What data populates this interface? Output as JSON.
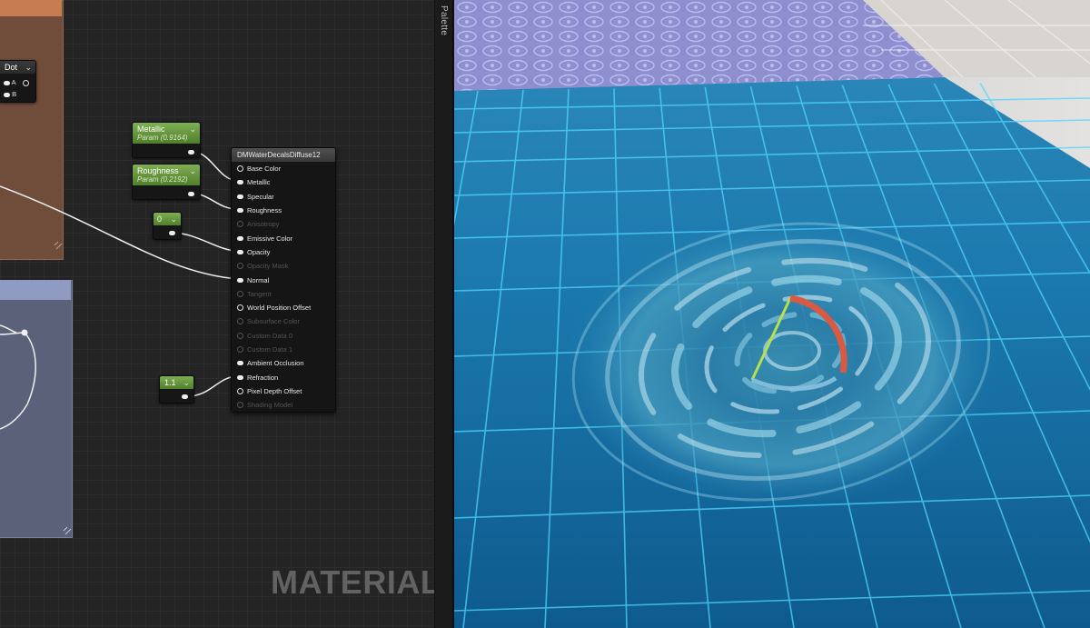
{
  "palette": {
    "label": "Palette"
  },
  "dot_node": {
    "title": "Dot",
    "pin_a": "A",
    "pin_b": "B"
  },
  "metallic_param": {
    "title": "Metallic",
    "subtitle": "Param (0.9164)"
  },
  "roughness_param": {
    "title": "Roughness",
    "subtitle": "Param (0.2192)"
  },
  "opacity_const": {
    "value": "0"
  },
  "refraction_const": {
    "value": "1.1"
  },
  "material_node": {
    "title": "DMWaterDecalsDiffuse12",
    "inputs": [
      {
        "label": "Base Color",
        "enabled": true
      },
      {
        "label": "Metallic",
        "enabled": true
      },
      {
        "label": "Specular",
        "enabled": true
      },
      {
        "label": "Roughness",
        "enabled": true
      },
      {
        "label": "Anisotropy",
        "enabled": false
      },
      {
        "label": "Emissive Color",
        "enabled": true
      },
      {
        "label": "Opacity",
        "enabled": true
      },
      {
        "label": "Opacity Mask",
        "enabled": false
      },
      {
        "label": "Normal",
        "enabled": true
      },
      {
        "label": "Tangent",
        "enabled": false
      },
      {
        "label": "World Position Offset",
        "enabled": true
      },
      {
        "label": "Subsurface Color",
        "enabled": false
      },
      {
        "label": "Custom Data 0",
        "enabled": false
      },
      {
        "label": "Custom Data 1",
        "enabled": false
      },
      {
        "label": "Ambient Occlusion",
        "enabled": true
      },
      {
        "label": "Refraction",
        "enabled": true
      },
      {
        "label": "Pixel Depth Offset",
        "enabled": true
      },
      {
        "label": "Shading Model",
        "enabled": false
      }
    ]
  },
  "graph_label": "MATERIAL",
  "colors": {
    "param_green": "#6a9a3e",
    "water": "#1476a8",
    "tile_line": "#5fd8ff"
  }
}
